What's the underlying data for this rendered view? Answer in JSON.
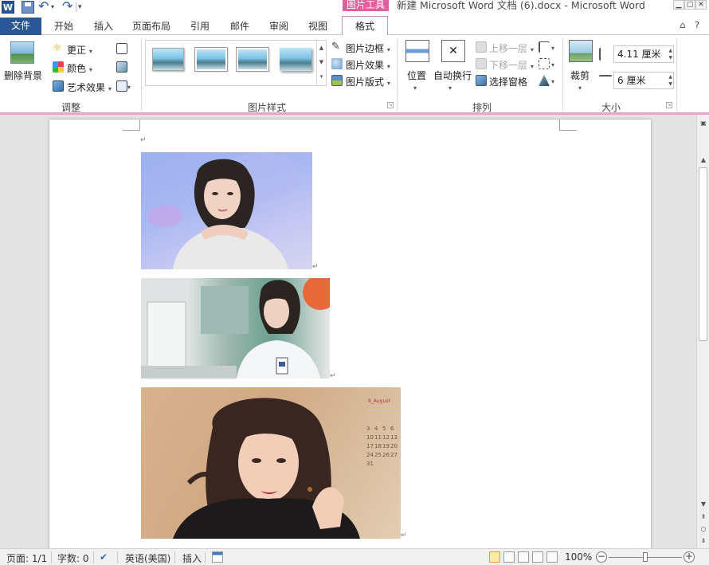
{
  "window": {
    "title": "新建 Microsoft Word 文档 (6).docx - Microsoft Word",
    "contextual_tab_group": "图片工具",
    "app_icon": "W"
  },
  "tabs": [
    "文件",
    "开始",
    "插入",
    "页面布局",
    "引用",
    "邮件",
    "审阅",
    "视图",
    "格式"
  ],
  "active_tab": "格式",
  "ribbon": {
    "adjust": {
      "label": "调整",
      "remove_background": "删除背景",
      "corrections": "更正",
      "color": "颜色",
      "artistic_effects": "艺术效果"
    },
    "picture_styles": {
      "label": "图片样式",
      "border": "图片边框",
      "effects": "图片效果",
      "layout": "图片版式"
    },
    "arrange": {
      "label": "排列",
      "position": "位置",
      "wrap_text": "自动换行",
      "bring_forward": "上移一层",
      "send_backward": "下移一层",
      "selection_pane": "选择窗格"
    },
    "size": {
      "label": "大小",
      "crop": "裁剪",
      "height": "4.11 厘米",
      "width": "6 厘米"
    }
  },
  "document": {
    "paragraph_mark": "↵",
    "calendar": {
      "header": "8_August",
      "numbers": [
        "3",
        "4",
        "5",
        "6",
        "10",
        "11",
        "12",
        "13",
        "17",
        "18",
        "19",
        "20",
        "24",
        "25",
        "26",
        "27",
        "31"
      ]
    }
  },
  "status": {
    "page": "页面: 1/1",
    "words": "字数: 0",
    "language": "英语(美国)",
    "mode": "插入",
    "zoom": "100%",
    "zoom_level": 1.0
  },
  "colors": {
    "accent_format_tab": "#e1609b",
    "file_tab": "#2b5797"
  }
}
